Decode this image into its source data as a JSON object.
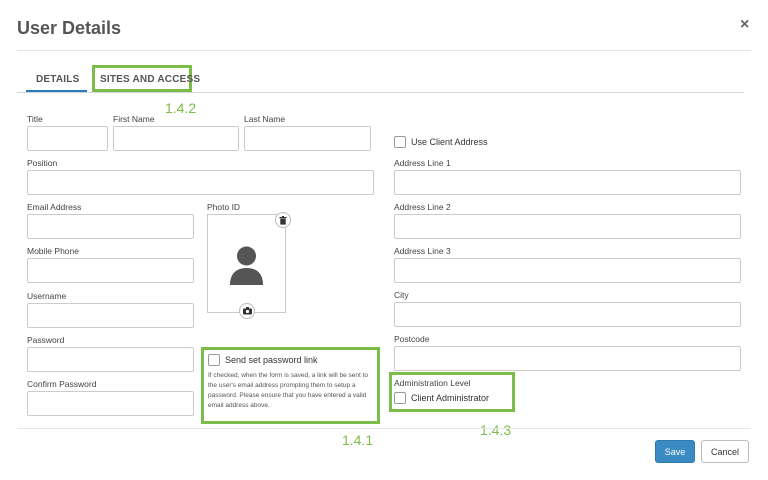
{
  "dialog": {
    "title": "User Details",
    "close_glyph": "×"
  },
  "tabs": [
    {
      "label": "DETAILS",
      "active": true
    },
    {
      "label": "SITES AND ACCESS",
      "active": false
    }
  ],
  "annotations": {
    "tab": "1.4.2",
    "password_link": "1.4.1",
    "admin_level": "1.4.3",
    "color": "#7cbd4a"
  },
  "form": {
    "title": {
      "label": "Title",
      "value": ""
    },
    "first_name": {
      "label": "First Name",
      "value": ""
    },
    "last_name": {
      "label": "Last Name",
      "value": ""
    },
    "position": {
      "label": "Position",
      "value": ""
    },
    "email": {
      "label": "Email Address",
      "value": ""
    },
    "mobile": {
      "label": "Mobile Phone",
      "value": ""
    },
    "username": {
      "label": "Username",
      "value": ""
    },
    "password": {
      "label": "Password",
      "value": ""
    },
    "confirm_password": {
      "label": "Confirm Password",
      "value": ""
    },
    "photo": {
      "label": "Photo ID",
      "delete_icon": "trash-icon",
      "upload_icon": "camera-icon",
      "placeholder_icon": "person-silhouette-icon"
    },
    "send_password": {
      "label": "Send set password link",
      "checked": false,
      "help": "If checked, when the form is saved, a link will be sent to the user's email address prompting them to setup a password. Please ensure that you have entered a valid email address above."
    },
    "use_client_address": {
      "label": "Use Client Address",
      "checked": false
    },
    "address1": {
      "label": "Address Line 1",
      "value": ""
    },
    "address2": {
      "label": "Address Line 2",
      "value": ""
    },
    "address3": {
      "label": "Address Line 3",
      "value": ""
    },
    "city": {
      "label": "City",
      "value": ""
    },
    "postcode": {
      "label": "Postcode",
      "value": ""
    },
    "admin_level": {
      "label": "Administration Level",
      "option_label": "Client Administrator",
      "checked": false
    }
  },
  "footer": {
    "save_label": "Save",
    "cancel_label": "Cancel"
  },
  "colors": {
    "primary": "#3a8ac4",
    "active_tab": "#2a7ab8"
  }
}
